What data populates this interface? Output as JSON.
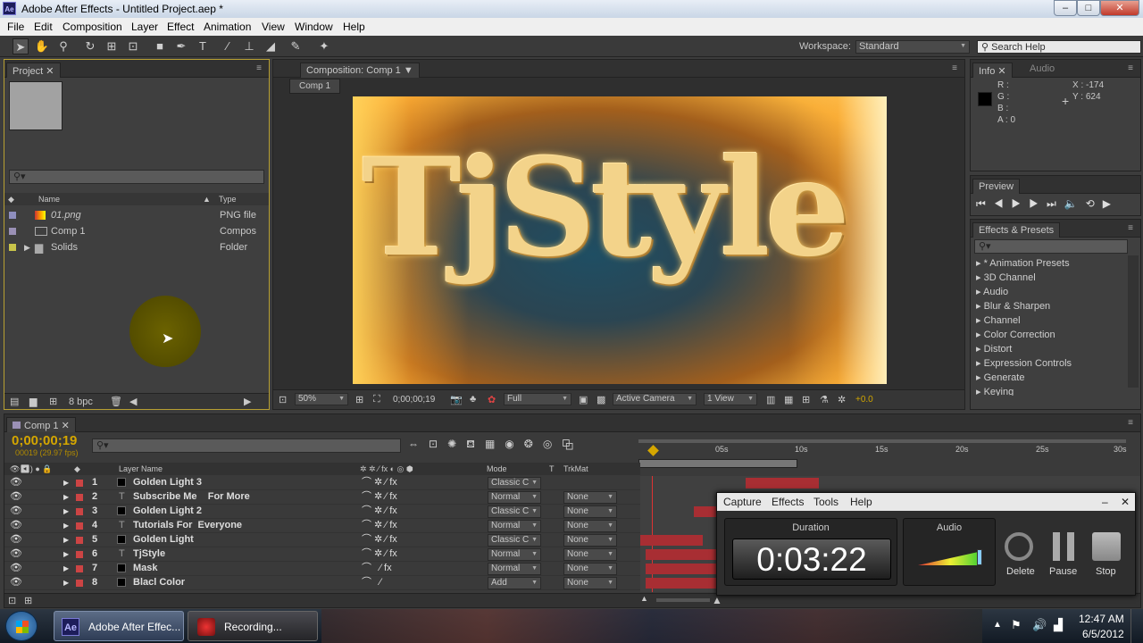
{
  "window": {
    "title": "Adobe After Effects - Untitled Project.aep *",
    "app_icon": "Ae"
  },
  "menu": [
    "File",
    "Edit",
    "Composition",
    "Layer",
    "Effect",
    "Animation",
    "View",
    "Window",
    "Help"
  ],
  "workspace": {
    "label": "Workspace:",
    "value": "Standard"
  },
  "search_help": "Search Help",
  "project": {
    "tab": "Project",
    "search_placeholder": "",
    "col_name": "Name",
    "col_type": "Type",
    "items": [
      {
        "name": "01.png",
        "type": "PNG file",
        "color": "#8f8fbf"
      },
      {
        "name": "Comp 1",
        "type": "Compos",
        "color": "#9a90b5"
      },
      {
        "name": "Solids",
        "type": "Folder",
        "color": "#c8c44a"
      }
    ],
    "bpc": "8 bpc"
  },
  "composition": {
    "tab": "Composition: Comp 1",
    "subtab": "Comp 1",
    "title_text": "TjStyle",
    "zoom": "50%",
    "timecode": "0;00;00;19",
    "resolution": "Full",
    "camera": "Active Camera",
    "view": "1 View",
    "exposure": "+0.0"
  },
  "info": {
    "tab_info": "Info",
    "tab_audio": "Audio",
    "r": "R :",
    "g": "G :",
    "b": "B :",
    "a": "A : 0",
    "x": "X : -174",
    "y": "Y : 624"
  },
  "preview": {
    "tab": "Preview"
  },
  "effects": {
    "tab": "Effects & Presets",
    "items": [
      "* Animation Presets",
      "3D Channel",
      "Audio",
      "Blur & Sharpen",
      "Channel",
      "Color Correction",
      "Distort",
      "Expression Controls",
      "Generate",
      "Keying"
    ]
  },
  "timeline": {
    "tab": "Comp 1",
    "timecode": "0;00;00;19",
    "fps": "00019 (29.97 fps)",
    "col_layer": "Layer Name",
    "col_mode": "Mode",
    "col_t": "T",
    "col_trkmat": "TrkMat",
    "ruler": [
      "05s",
      "10s",
      "15s",
      "20s",
      "25s",
      "30s"
    ],
    "layers": [
      {
        "num": "1",
        "name": "Golden Light 3",
        "type": "solid",
        "mode": "Classic C",
        "trkmat": ""
      },
      {
        "num": "2",
        "name": "Subscribe Me    For More",
        "type": "text",
        "mode": "Normal",
        "trkmat": "None"
      },
      {
        "num": "3",
        "name": "Golden Light 2",
        "type": "solid",
        "mode": "Classic C",
        "trkmat": "None"
      },
      {
        "num": "4",
        "name": "Tutorials For  Everyone",
        "type": "text",
        "mode": "Normal",
        "trkmat": "None"
      },
      {
        "num": "5",
        "name": "Golden Light",
        "type": "solid",
        "mode": "Classic C",
        "trkmat": "None"
      },
      {
        "num": "6",
        "name": "TjStyle",
        "type": "text",
        "mode": "Normal",
        "trkmat": "None"
      },
      {
        "num": "7",
        "name": "Mask",
        "type": "solid",
        "mode": "Normal",
        "trkmat": "None"
      },
      {
        "num": "8",
        "name": "Blacl Color",
        "type": "solid",
        "mode": "Add",
        "trkmat": "None"
      }
    ]
  },
  "recorder": {
    "menu": [
      "Capture",
      "Effects",
      "Tools",
      "Help"
    ],
    "duration_label": "Duration",
    "duration": "0:03:22",
    "audio_label": "Audio",
    "delete": "Delete",
    "pause": "Pause",
    "stop": "Stop"
  },
  "taskbar": {
    "items": [
      "Adobe After Effec...",
      "Recording..."
    ],
    "time": "12:47 AM",
    "date": "6/5/2012"
  }
}
